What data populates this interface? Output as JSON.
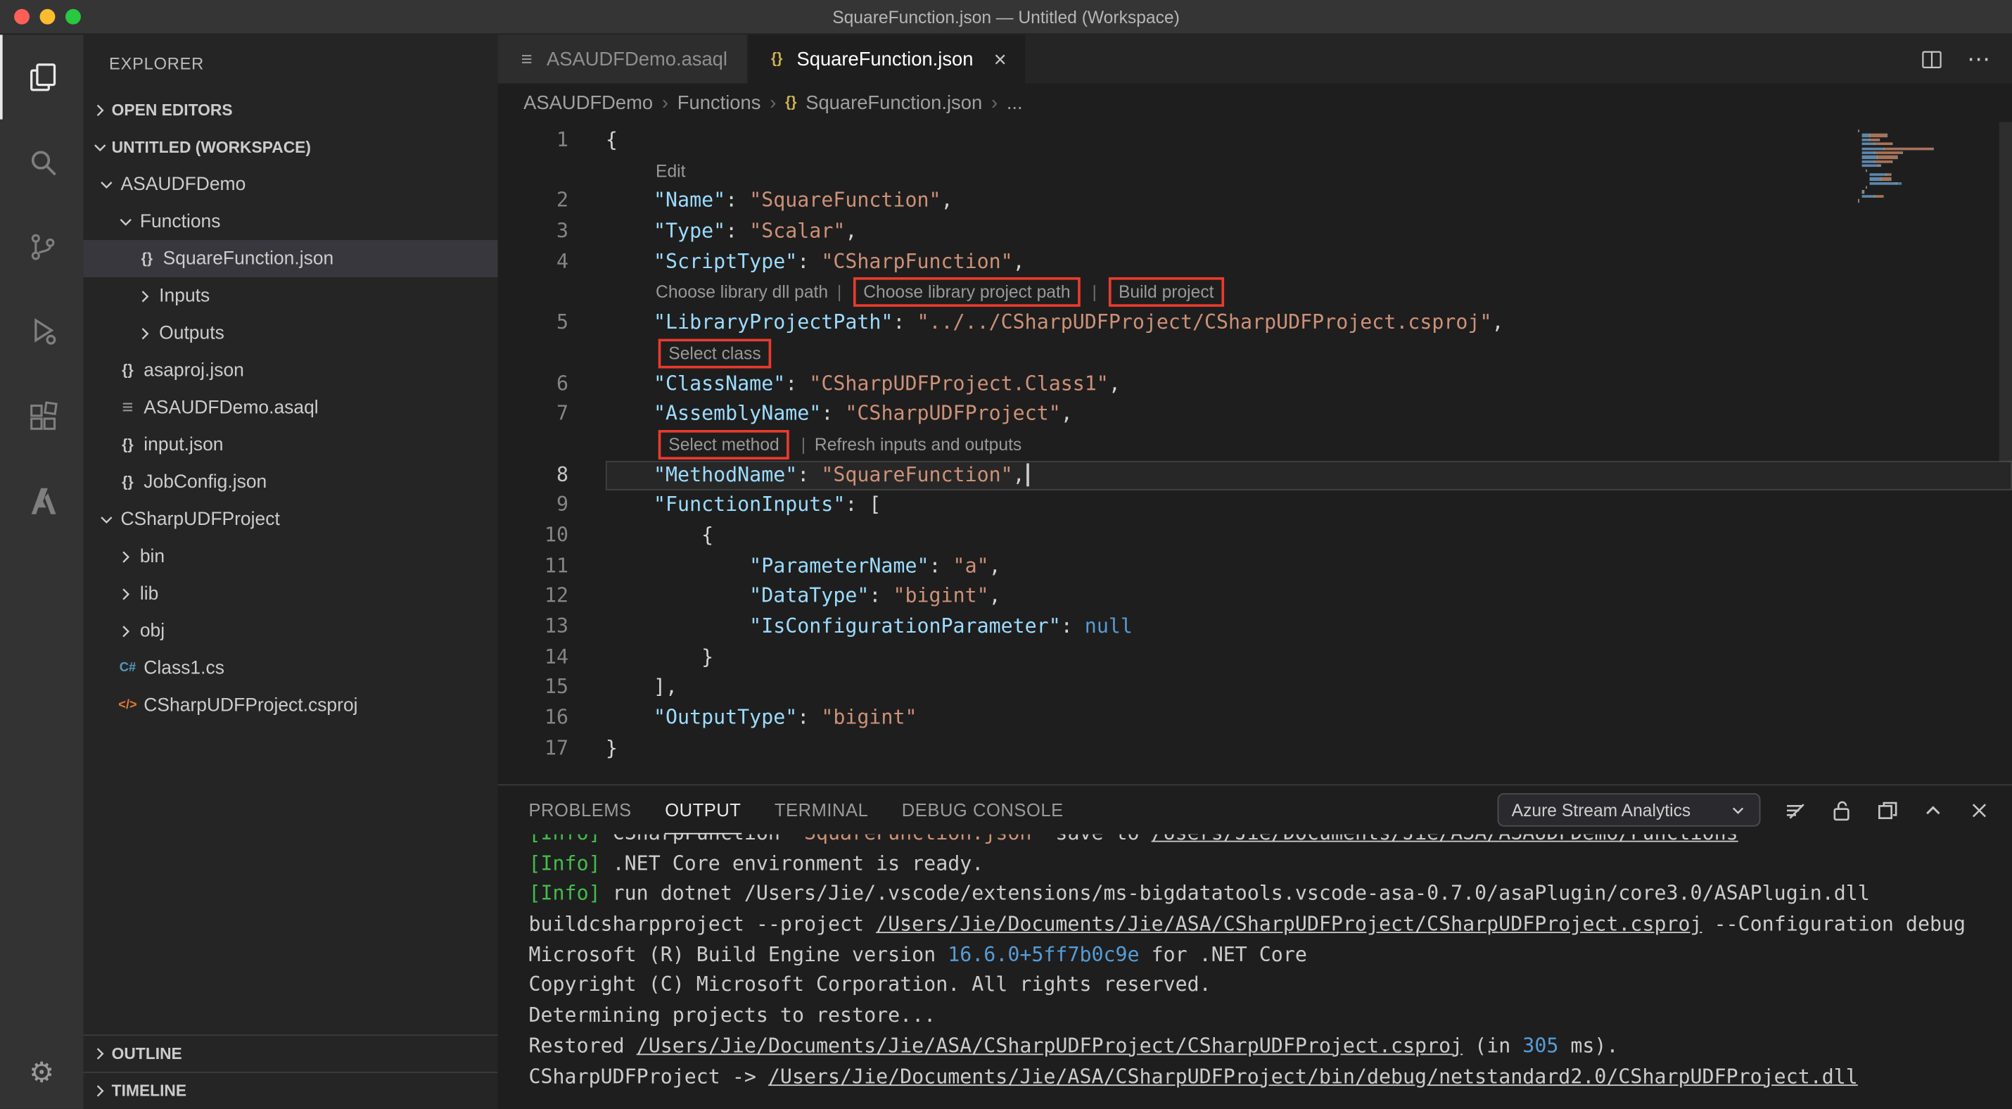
{
  "window": {
    "title": "SquareFunction.json — Untitled (Workspace)"
  },
  "activity_bar": {
    "items": [
      {
        "name": "explorer",
        "active": true
      },
      {
        "name": "search",
        "active": false
      },
      {
        "name": "source-control",
        "active": false
      },
      {
        "name": "run-debug",
        "active": false
      },
      {
        "name": "extensions",
        "active": false
      },
      {
        "name": "azure",
        "active": false
      }
    ],
    "settings_label": "settings"
  },
  "sidebar": {
    "title": "EXPLORER",
    "open_editors_label": "OPEN EDITORS",
    "workspace_label": "UNTITLED (WORKSPACE)",
    "outline_label": "OUTLINE",
    "timeline_label": "TIMELINE",
    "tree": [
      {
        "label": "ASAUDFDemo",
        "indent": 0,
        "type": "folder-open",
        "selected": false
      },
      {
        "label": "Functions",
        "indent": 1,
        "type": "folder-open",
        "selected": false
      },
      {
        "label": "SquareFunction.json",
        "indent": 2,
        "type": "json",
        "selected": true
      },
      {
        "label": "Inputs",
        "indent": 2,
        "type": "folder",
        "selected": false
      },
      {
        "label": "Outputs",
        "indent": 2,
        "type": "folder",
        "selected": false
      },
      {
        "label": "asaproj.json",
        "indent": 1,
        "type": "json",
        "selected": false
      },
      {
        "label": "ASAUDFDemo.asaql",
        "indent": 1,
        "type": "asaql",
        "selected": false
      },
      {
        "label": "input.json",
        "indent": 1,
        "type": "json",
        "selected": false
      },
      {
        "label": "JobConfig.json",
        "indent": 1,
        "type": "json",
        "selected": false
      },
      {
        "label": "CSharpUDFProject",
        "indent": 0,
        "type": "folder-open",
        "selected": false
      },
      {
        "label": "bin",
        "indent": 1,
        "type": "folder",
        "selected": false
      },
      {
        "label": "lib",
        "indent": 1,
        "type": "folder",
        "selected": false
      },
      {
        "label": "obj",
        "indent": 1,
        "type": "folder",
        "selected": false
      },
      {
        "label": "Class1.cs",
        "indent": 1,
        "type": "csharp",
        "selected": false
      },
      {
        "label": "CSharpUDFProject.csproj",
        "indent": 1,
        "type": "csproj",
        "selected": false
      }
    ]
  },
  "editor": {
    "tabs": [
      {
        "label": "ASAUDFDemo.asaql",
        "icon": "asaql",
        "active": false
      },
      {
        "label": "SquareFunction.json",
        "icon": "json",
        "active": true
      }
    ],
    "breadcrumbs": [
      {
        "label": "ASAUDFDemo"
      },
      {
        "label": "Functions"
      },
      {
        "label": "SquareFunction.json",
        "icon": "json"
      },
      {
        "label": "..."
      }
    ],
    "rows": [
      {
        "kind": "code",
        "num": 1,
        "segments": [
          {
            "t": "{",
            "c": "pun"
          }
        ]
      },
      {
        "kind": "lens",
        "segments": [
          {
            "t": "Edit"
          }
        ]
      },
      {
        "kind": "code",
        "num": 2,
        "segments": [
          {
            "t": "    ",
            "c": "plain"
          },
          {
            "t": "\"Name\"",
            "c": "key"
          },
          {
            "t": ": ",
            "c": "pun"
          },
          {
            "t": "\"SquareFunction\"",
            "c": "str"
          },
          {
            "t": ",",
            "c": "pun"
          }
        ]
      },
      {
        "kind": "code",
        "num": 3,
        "segments": [
          {
            "t": "    ",
            "c": "plain"
          },
          {
            "t": "\"Type\"",
            "c": "key"
          },
          {
            "t": ": ",
            "c": "pun"
          },
          {
            "t": "\"Scalar\"",
            "c": "str"
          },
          {
            "t": ",",
            "c": "pun"
          }
        ]
      },
      {
        "kind": "code",
        "num": 4,
        "segments": [
          {
            "t": "    ",
            "c": "plain"
          },
          {
            "t": "\"ScriptType\"",
            "c": "key"
          },
          {
            "t": ": ",
            "c": "pun"
          },
          {
            "t": "\"CSharpFunction\"",
            "c": "str"
          },
          {
            "t": ",",
            "c": "pun"
          }
        ]
      },
      {
        "kind": "lens",
        "segments": [
          {
            "t": "Choose library dll path"
          },
          {
            "t": "|",
            "sep": true
          },
          {
            "t": "Choose library project path",
            "box": true
          },
          {
            "t": "|",
            "sep": true
          },
          {
            "t": "Build project",
            "box": true
          }
        ]
      },
      {
        "kind": "code",
        "num": 5,
        "segments": [
          {
            "t": "    ",
            "c": "plain"
          },
          {
            "t": "\"LibraryProjectPath\"",
            "c": "key"
          },
          {
            "t": ": ",
            "c": "pun"
          },
          {
            "t": "\"../../CSharpUDFProject/CSharpUDFProject.csproj\"",
            "c": "str"
          },
          {
            "t": ",",
            "c": "pun"
          }
        ]
      },
      {
        "kind": "lens",
        "segments": [
          {
            "t": "Select class",
            "box": true
          }
        ]
      },
      {
        "kind": "code",
        "num": 6,
        "segments": [
          {
            "t": "    ",
            "c": "plain"
          },
          {
            "t": "\"ClassName\"",
            "c": "key"
          },
          {
            "t": ": ",
            "c": "pun"
          },
          {
            "t": "\"CSharpUDFProject.Class1\"",
            "c": "str"
          },
          {
            "t": ",",
            "c": "pun"
          }
        ]
      },
      {
        "kind": "code",
        "num": 7,
        "segments": [
          {
            "t": "    ",
            "c": "plain"
          },
          {
            "t": "\"AssemblyName\"",
            "c": "key"
          },
          {
            "t": ": ",
            "c": "pun"
          },
          {
            "t": "\"CSharpUDFProject\"",
            "c": "str"
          },
          {
            "t": ",",
            "c": "pun"
          }
        ]
      },
      {
        "kind": "lens",
        "segments": [
          {
            "t": "Select method",
            "box": true
          },
          {
            "t": "|",
            "sep": true
          },
          {
            "t": "Refresh inputs and outputs"
          }
        ]
      },
      {
        "kind": "code",
        "num": 8,
        "current": true,
        "cursor": true,
        "segments": [
          {
            "t": "    ",
            "c": "plain"
          },
          {
            "t": "\"MethodName\"",
            "c": "key"
          },
          {
            "t": ": ",
            "c": "pun"
          },
          {
            "t": "\"SquareFunction\"",
            "c": "str"
          },
          {
            "t": ",",
            "c": "pun"
          }
        ]
      },
      {
        "kind": "code",
        "num": 9,
        "segments": [
          {
            "t": "    ",
            "c": "plain"
          },
          {
            "t": "\"FunctionInputs\"",
            "c": "key"
          },
          {
            "t": ": ",
            "c": "pun"
          },
          {
            "t": "[",
            "c": "pun"
          }
        ]
      },
      {
        "kind": "code",
        "num": 10,
        "segments": [
          {
            "t": "        ",
            "c": "plain"
          },
          {
            "t": "{",
            "c": "pun"
          }
        ]
      },
      {
        "kind": "code",
        "num": 11,
        "segments": [
          {
            "t": "            ",
            "c": "plain"
          },
          {
            "t": "\"ParameterName\"",
            "c": "key"
          },
          {
            "t": ": ",
            "c": "pun"
          },
          {
            "t": "\"a\"",
            "c": "str"
          },
          {
            "t": ",",
            "c": "pun"
          }
        ]
      },
      {
        "kind": "code",
        "num": 12,
        "segments": [
          {
            "t": "            ",
            "c": "plain"
          },
          {
            "t": "\"DataType\"",
            "c": "key"
          },
          {
            "t": ": ",
            "c": "pun"
          },
          {
            "t": "\"bigint\"",
            "c": "str"
          },
          {
            "t": ",",
            "c": "pun"
          }
        ]
      },
      {
        "kind": "code",
        "num": 13,
        "segments": [
          {
            "t": "            ",
            "c": "plain"
          },
          {
            "t": "\"IsConfigurationParameter\"",
            "c": "key"
          },
          {
            "t": ": ",
            "c": "pun"
          },
          {
            "t": "null",
            "c": "kw"
          }
        ]
      },
      {
        "kind": "code",
        "num": 14,
        "segments": [
          {
            "t": "        ",
            "c": "plain"
          },
          {
            "t": "}",
            "c": "pun"
          }
        ]
      },
      {
        "kind": "code",
        "num": 15,
        "segments": [
          {
            "t": "    ",
            "c": "plain"
          },
          {
            "t": "],",
            "c": "pun"
          }
        ]
      },
      {
        "kind": "code",
        "num": 16,
        "segments": [
          {
            "t": "    ",
            "c": "plain"
          },
          {
            "t": "\"OutputType\"",
            "c": "key"
          },
          {
            "t": ": ",
            "c": "pun"
          },
          {
            "t": "\"bigint\"",
            "c": "str"
          }
        ]
      },
      {
        "kind": "code",
        "num": 17,
        "segments": [
          {
            "t": "}",
            "c": "pun"
          }
        ]
      }
    ]
  },
  "panel": {
    "tabs": [
      "PROBLEMS",
      "OUTPUT",
      "TERMINAL",
      "DEBUG CONSOLE"
    ],
    "active_tab": 1,
    "channel": "Azure Stream Analytics"
  },
  "output": {
    "lines": [
      {
        "segments": [
          {
            "t": "[Info] ",
            "c": "info"
          },
          {
            "t": "CSharpFunction  ",
            "c": "plain"
          },
          {
            "t": "SquareFunction.json",
            "c": "file"
          },
          {
            "t": "  save to ",
            "c": "plain"
          },
          {
            "t": "/Users/Jie/Documents/Jie/ASA/ASAUDFDemo/Functions",
            "c": "link"
          }
        ]
      },
      {
        "segments": [
          {
            "t": "[Info] ",
            "c": "info"
          },
          {
            "t": ".NET Core environment is ready.",
            "c": "plain"
          }
        ]
      },
      {
        "segments": [
          {
            "t": "[Info] ",
            "c": "info"
          },
          {
            "t": "run dotnet /Users/Jie/.vscode/extensions/ms-bigdatatools.vscode-asa-0.7.0/asaPlugin/core3.0/ASAPlugin.dll",
            "c": "plain"
          }
        ]
      },
      {
        "segments": [
          {
            "t": "buildcsharpproject --project ",
            "c": "plain"
          },
          {
            "t": "/Users/Jie/Documents/Jie/ASA/CSharpUDFProject/CSharpUDFProject.csproj",
            "c": "link"
          },
          {
            "t": " --Configuration debug",
            "c": "plain"
          }
        ]
      },
      {
        "segments": [
          {
            "t": "Microsoft (R) Build Engine version ",
            "c": "plain"
          },
          {
            "t": "16.6.0+5ff7b0c9e",
            "c": "num"
          },
          {
            "t": " for .NET Core",
            "c": "plain"
          }
        ]
      },
      {
        "segments": [
          {
            "t": "Copyright (C) Microsoft Corporation. All rights reserved.",
            "c": "plain"
          }
        ]
      },
      {
        "segments": [
          {
            "t": "Determining projects to restore...",
            "c": "plain"
          }
        ]
      },
      {
        "segments": [
          {
            "t": "Restored ",
            "c": "plain"
          },
          {
            "t": "/Users/Jie/Documents/Jie/ASA/CSharpUDFProject/CSharpUDFProject.csproj",
            "c": "link"
          },
          {
            "t": " (in ",
            "c": "plain"
          },
          {
            "t": "305",
            "c": "num"
          },
          {
            "t": " ms).",
            "c": "plain"
          }
        ]
      },
      {
        "segments": [
          {
            "t": "CSharpUDFProject -> ",
            "c": "plain"
          },
          {
            "t": "/Users/Jie/Documents/Jie/ASA/CSharpUDFProject/bin/debug/netstandard2.0/CSharpUDFProject.dll",
            "c": "link"
          }
        ]
      }
    ]
  }
}
